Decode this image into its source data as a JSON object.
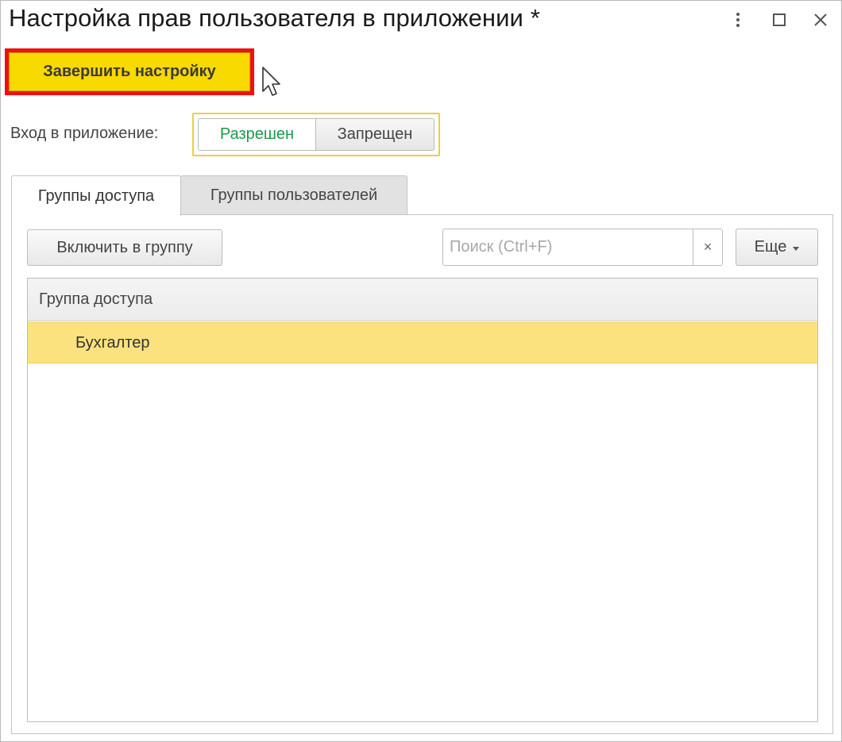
{
  "window": {
    "title": "Настройка прав пользователя в приложении *"
  },
  "toolbar": {
    "finish_label": "Завершить настройку"
  },
  "login": {
    "label": "Вход в приложение:",
    "options": [
      "Разрешен",
      "Запрещен"
    ],
    "selected": "Разрешен"
  },
  "tabs": [
    {
      "label": "Группы доступа",
      "active": true
    },
    {
      "label": "Группы пользователей",
      "active": false
    }
  ],
  "panel": {
    "include_label": "Включить в группу",
    "search_placeholder": "Поиск (Ctrl+F)",
    "search_value": "",
    "clear_icon": "×",
    "more_label": "Еще"
  },
  "grid": {
    "column_header": "Группа доступа",
    "rows": [
      {
        "name": "Бухгалтер",
        "selected": true
      }
    ]
  },
  "colors": {
    "accent_yellow": "#f8d900",
    "highlight_red": "#f01010",
    "selected_row": "#fbe27f",
    "allowed_green": "#1a9a4a"
  }
}
